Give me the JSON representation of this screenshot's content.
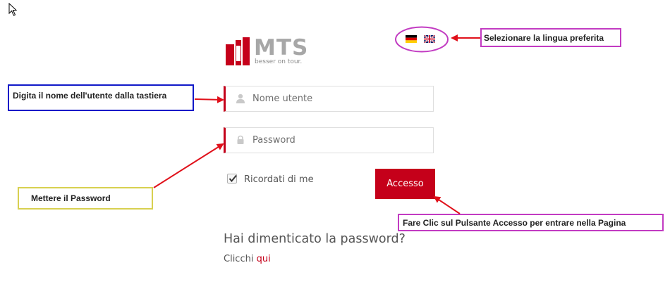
{
  "logo": {
    "brand": "MTS",
    "tagline": "besser on tour."
  },
  "language_flags": [
    {
      "name": "german-flag-icon",
      "lang": "de"
    },
    {
      "name": "uk-flag-icon",
      "lang": "en"
    }
  ],
  "login_form": {
    "username_placeholder": "Nome utente",
    "password_placeholder": "Password",
    "remember_label": "Ricordati di me",
    "remember_checked": true,
    "submit_label": "Accesso"
  },
  "forgot": {
    "title": "Hai dimenticato la password?",
    "prompt": "Clicchi",
    "link_label": "qui"
  },
  "annotations": {
    "language": "Selezionare la lingua preferita",
    "username": "Digita il nome dell'utente dalla tastiera",
    "password": "Mettere il Password",
    "submit": "Fare Clic sul Pulsante Accesso per entrare nella Pagina"
  },
  "colors": {
    "brand_red": "#c5001a",
    "annotation_arrow": "#e0101a",
    "callout_blue": "#1018c8",
    "callout_yellow": "#d8d050",
    "callout_magenta": "#c23bc2"
  }
}
